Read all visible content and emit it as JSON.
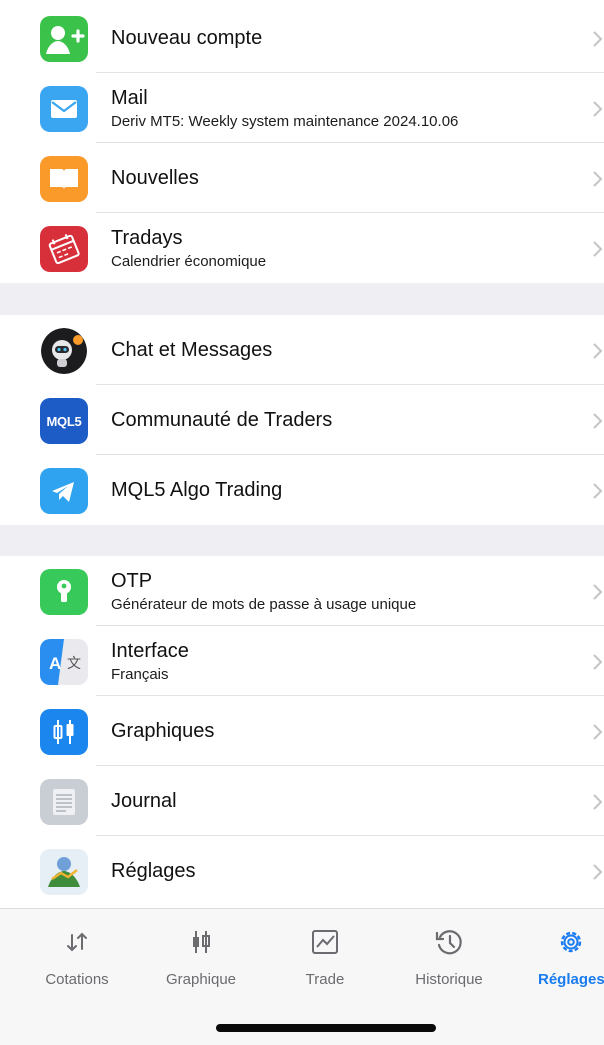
{
  "menu": {
    "items": [
      {
        "title": "Nouveau compte",
        "subtitle": ""
      },
      {
        "title": "Mail",
        "subtitle": "Deriv MT5: Weekly system maintenance 2024.10.06"
      },
      {
        "title": "Nouvelles",
        "subtitle": ""
      },
      {
        "title": "Tradays",
        "subtitle": "Calendrier économique"
      },
      {
        "title": "Chat et Messages",
        "subtitle": ""
      },
      {
        "title": "Communauté de Traders",
        "subtitle": "",
        "icon_text": "MQL5"
      },
      {
        "title": "MQL5 Algo Trading",
        "subtitle": ""
      },
      {
        "title": "OTP",
        "subtitle": "Générateur de mots de passe à usage unique"
      },
      {
        "title": "Interface",
        "subtitle": "Français"
      },
      {
        "title": "Graphiques",
        "subtitle": ""
      },
      {
        "title": "Journal",
        "subtitle": ""
      },
      {
        "title": "Réglages",
        "subtitle": ""
      }
    ]
  },
  "tabbar": {
    "tabs": [
      {
        "label": "Cotations",
        "icon": "arrows-updown-icon"
      },
      {
        "label": "Graphique",
        "icon": "candlestick-icon"
      },
      {
        "label": "Trade",
        "icon": "trade-chart-icon"
      },
      {
        "label": "Historique",
        "icon": "history-icon"
      },
      {
        "label": "Réglages",
        "icon": "gear-icon",
        "active": true
      }
    ]
  },
  "colors": {
    "accent": "#1a7cf0",
    "section_gap": "#efeff3",
    "green": "#34c759",
    "blue": "#2f9bef",
    "orange": "#f99a2a",
    "red": "#d8303a"
  }
}
